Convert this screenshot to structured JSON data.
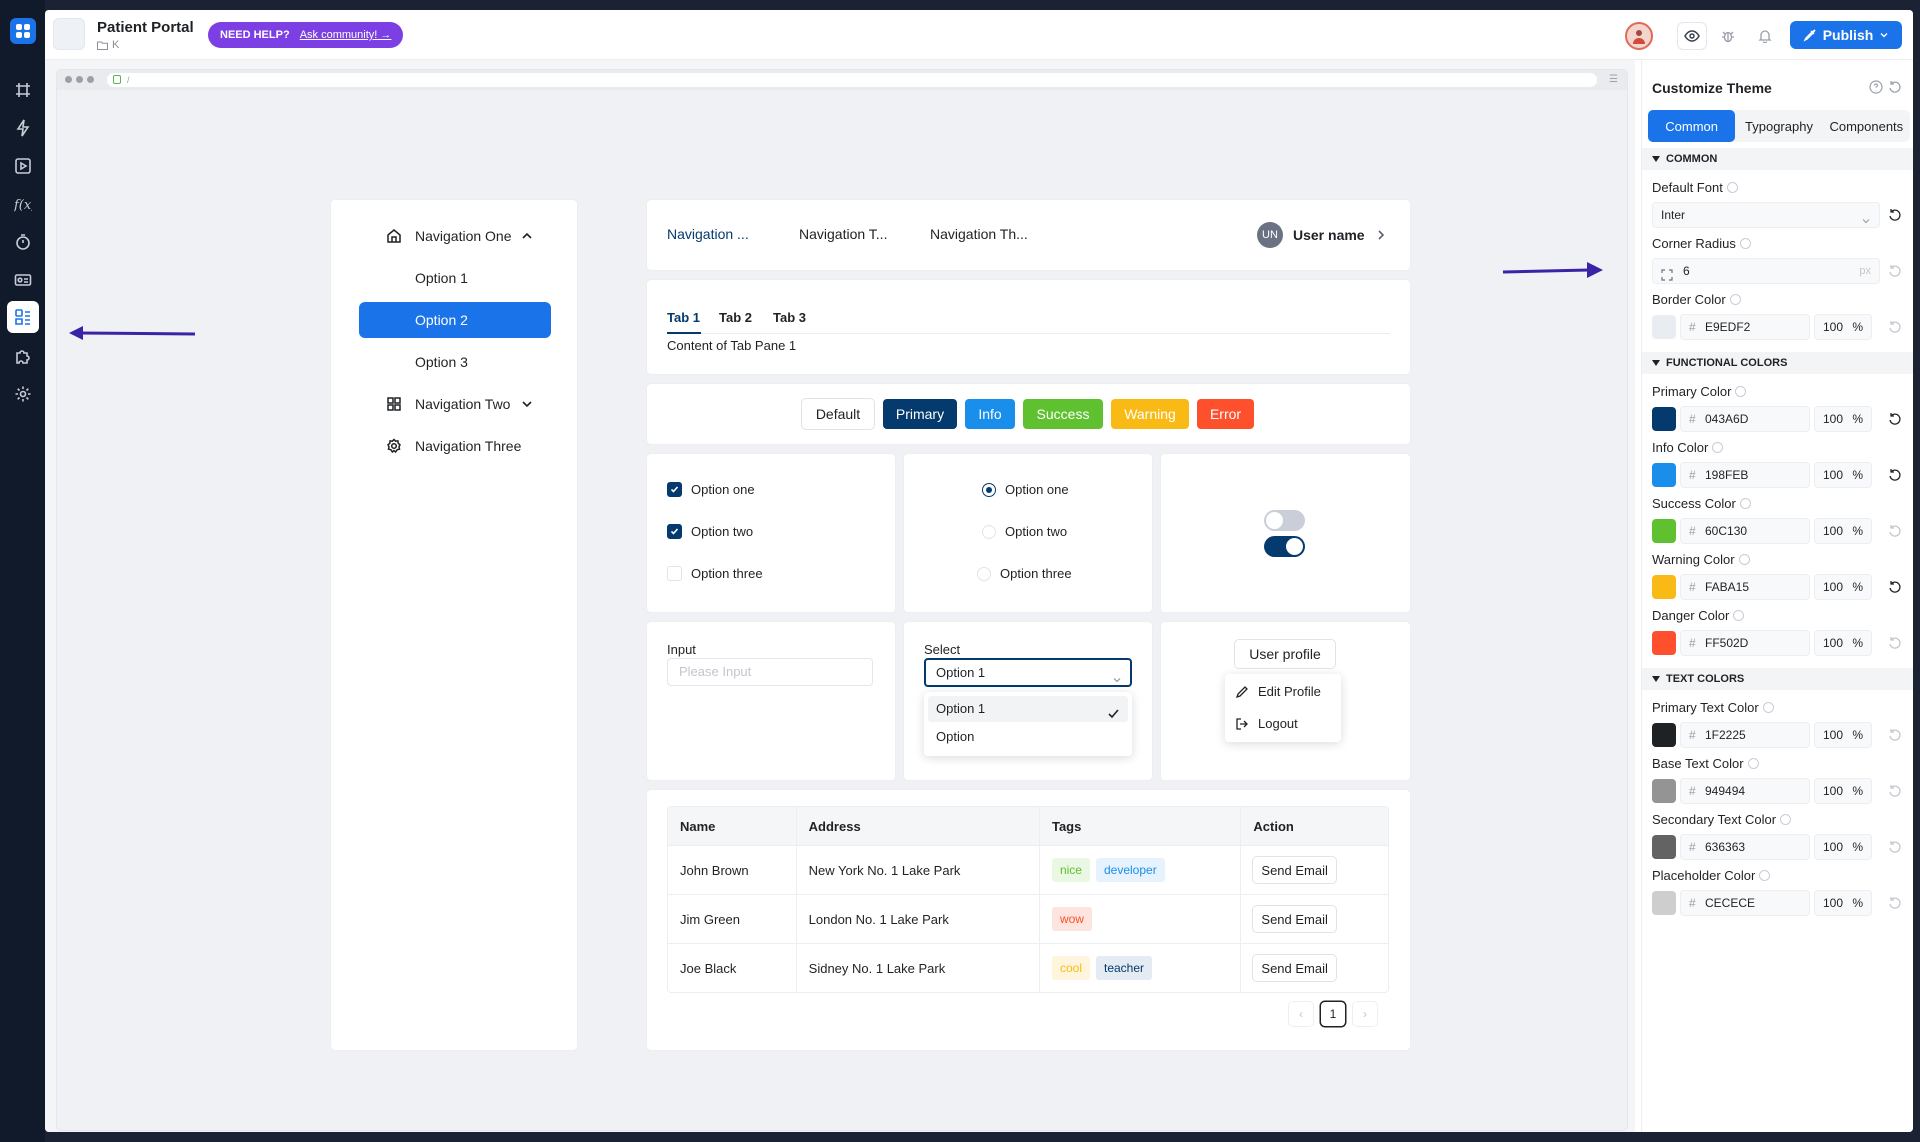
{
  "app": {
    "title": "Patient Portal",
    "subtitle": "K",
    "help_label": "NEED HELP?",
    "help_link": "Ask community!",
    "publish_label": "Publish"
  },
  "browser": {
    "url": "/"
  },
  "menu": {
    "items": [
      {
        "label": "Navigation One",
        "icon": "home-icon"
      },
      {
        "label": "Option 1"
      },
      {
        "label": "Option 2"
      },
      {
        "label": "Option 3"
      },
      {
        "label": "Navigation Two",
        "icon": "grid-icon"
      },
      {
        "label": "Navigation Three",
        "icon": "gear-icon"
      }
    ]
  },
  "nav": {
    "links": [
      "Navigation ...",
      "Navigation T...",
      "Navigation Th..."
    ],
    "user_initials": "UN",
    "user_name": "User name"
  },
  "tabs": {
    "items": [
      "Tab 1",
      "Tab 2",
      "Tab 3"
    ],
    "content": "Content of Tab Pane 1"
  },
  "buttons": {
    "items": [
      {
        "label": "Default",
        "color": "#ffffff"
      },
      {
        "label": "Primary",
        "color": "#043A6D"
      },
      {
        "label": "Info",
        "color": "#198FEB"
      },
      {
        "label": "Success",
        "color": "#60C130"
      },
      {
        "label": "Warning",
        "color": "#FABA15"
      },
      {
        "label": "Error",
        "color": "#FF502D"
      }
    ]
  },
  "checkboxes": [
    {
      "label": "Option one",
      "checked": true
    },
    {
      "label": "Option two",
      "checked": true
    },
    {
      "label": "Option three",
      "checked": false
    }
  ],
  "radios": [
    {
      "label": "Option one",
      "checked": true
    },
    {
      "label": "Option two",
      "checked": false
    },
    {
      "label": "Option three",
      "checked": false
    }
  ],
  "switches": [
    {
      "on": false
    },
    {
      "on": true
    }
  ],
  "input": {
    "label": "Input",
    "placeholder": "Please Input"
  },
  "select": {
    "label": "Select",
    "value": "Option 1",
    "options": [
      "Option 1",
      "Option"
    ]
  },
  "profile": {
    "button": "User profile",
    "menu": [
      "Edit Profile",
      "Logout"
    ]
  },
  "table": {
    "columns": [
      "Name",
      "Address",
      "Tags",
      "Action"
    ],
    "rows": [
      {
        "name": "John Brown",
        "address": "New York No. 1 Lake Park",
        "tags": [
          "nice",
          "developer"
        ],
        "action": "Send Email"
      },
      {
        "name": "Jim Green",
        "address": "London No. 1 Lake Park",
        "tags": [
          "wow"
        ],
        "action": "Send Email"
      },
      {
        "name": "Joe Black",
        "address": "Sidney No. 1 Lake Park",
        "tags": [
          "cool",
          "teacher"
        ],
        "action": "Send Email"
      }
    ],
    "page": "1"
  },
  "panel": {
    "title": "Customize Theme",
    "tabs": [
      "Common",
      "Typography",
      "Components"
    ],
    "sections": {
      "common": "COMMON",
      "functional": "FUNCTIONAL COLORS",
      "text": "TEXT COLORS"
    },
    "default_font_label": "Default Font",
    "default_font": "Inter",
    "corner_radius_label": "Corner Radius",
    "corner_radius": "6",
    "corner_radius_unit": "px",
    "colors": [
      {
        "label": "Border Color",
        "hex": "E9EDF2",
        "opacity": "100",
        "swatch": "#E9EDF2"
      },
      {
        "label": "Primary Color",
        "hex": "043A6D",
        "opacity": "100",
        "swatch": "#043A6D"
      },
      {
        "label": "Info Color",
        "hex": "198FEB",
        "opacity": "100",
        "swatch": "#198FEB"
      },
      {
        "label": "Success Color",
        "hex": "60C130",
        "opacity": "100",
        "swatch": "#60C130"
      },
      {
        "label": "Warning Color",
        "hex": "FABA15",
        "opacity": "100",
        "swatch": "#FABA15"
      },
      {
        "label": "Danger Color",
        "hex": "FF502D",
        "opacity": "100",
        "swatch": "#FF502D"
      },
      {
        "label": "Primary Text Color",
        "hex": "1F2225",
        "opacity": "100",
        "swatch": "#1F2225"
      },
      {
        "label": "Base Text Color",
        "hex": "949494",
        "opacity": "100",
        "swatch": "#949494"
      },
      {
        "label": "Secondary Text Color",
        "hex": "636363",
        "opacity": "100",
        "swatch": "#636363"
      },
      {
        "label": "Placeholder Color",
        "hex": "CECECE",
        "opacity": "100",
        "swatch": "#CECECE"
      }
    ],
    "percent_unit": "%"
  }
}
